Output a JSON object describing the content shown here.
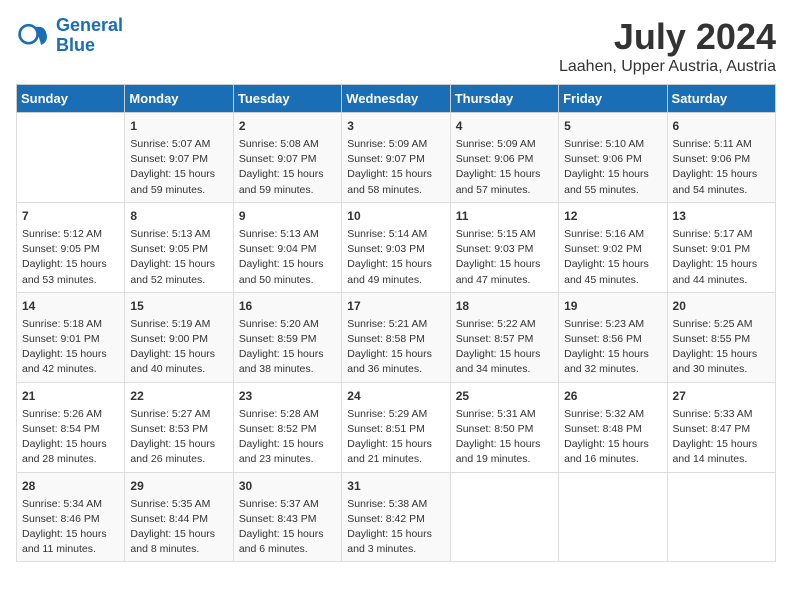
{
  "logo": {
    "line1": "General",
    "line2": "Blue"
  },
  "title": "July 2024",
  "location": "Laahen, Upper Austria, Austria",
  "days_of_week": [
    "Sunday",
    "Monday",
    "Tuesday",
    "Wednesday",
    "Thursday",
    "Friday",
    "Saturday"
  ],
  "weeks": [
    [
      {
        "day": "",
        "info": ""
      },
      {
        "day": "1",
        "info": "Sunrise: 5:07 AM\nSunset: 9:07 PM\nDaylight: 15 hours\nand 59 minutes."
      },
      {
        "day": "2",
        "info": "Sunrise: 5:08 AM\nSunset: 9:07 PM\nDaylight: 15 hours\nand 59 minutes."
      },
      {
        "day": "3",
        "info": "Sunrise: 5:09 AM\nSunset: 9:07 PM\nDaylight: 15 hours\nand 58 minutes."
      },
      {
        "day": "4",
        "info": "Sunrise: 5:09 AM\nSunset: 9:06 PM\nDaylight: 15 hours\nand 57 minutes."
      },
      {
        "day": "5",
        "info": "Sunrise: 5:10 AM\nSunset: 9:06 PM\nDaylight: 15 hours\nand 55 minutes."
      },
      {
        "day": "6",
        "info": "Sunrise: 5:11 AM\nSunset: 9:06 PM\nDaylight: 15 hours\nand 54 minutes."
      }
    ],
    [
      {
        "day": "7",
        "info": "Sunrise: 5:12 AM\nSunset: 9:05 PM\nDaylight: 15 hours\nand 53 minutes."
      },
      {
        "day": "8",
        "info": "Sunrise: 5:13 AM\nSunset: 9:05 PM\nDaylight: 15 hours\nand 52 minutes."
      },
      {
        "day": "9",
        "info": "Sunrise: 5:13 AM\nSunset: 9:04 PM\nDaylight: 15 hours\nand 50 minutes."
      },
      {
        "day": "10",
        "info": "Sunrise: 5:14 AM\nSunset: 9:03 PM\nDaylight: 15 hours\nand 49 minutes."
      },
      {
        "day": "11",
        "info": "Sunrise: 5:15 AM\nSunset: 9:03 PM\nDaylight: 15 hours\nand 47 minutes."
      },
      {
        "day": "12",
        "info": "Sunrise: 5:16 AM\nSunset: 9:02 PM\nDaylight: 15 hours\nand 45 minutes."
      },
      {
        "day": "13",
        "info": "Sunrise: 5:17 AM\nSunset: 9:01 PM\nDaylight: 15 hours\nand 44 minutes."
      }
    ],
    [
      {
        "day": "14",
        "info": "Sunrise: 5:18 AM\nSunset: 9:01 PM\nDaylight: 15 hours\nand 42 minutes."
      },
      {
        "day": "15",
        "info": "Sunrise: 5:19 AM\nSunset: 9:00 PM\nDaylight: 15 hours\nand 40 minutes."
      },
      {
        "day": "16",
        "info": "Sunrise: 5:20 AM\nSunset: 8:59 PM\nDaylight: 15 hours\nand 38 minutes."
      },
      {
        "day": "17",
        "info": "Sunrise: 5:21 AM\nSunset: 8:58 PM\nDaylight: 15 hours\nand 36 minutes."
      },
      {
        "day": "18",
        "info": "Sunrise: 5:22 AM\nSunset: 8:57 PM\nDaylight: 15 hours\nand 34 minutes."
      },
      {
        "day": "19",
        "info": "Sunrise: 5:23 AM\nSunset: 8:56 PM\nDaylight: 15 hours\nand 32 minutes."
      },
      {
        "day": "20",
        "info": "Sunrise: 5:25 AM\nSunset: 8:55 PM\nDaylight: 15 hours\nand 30 minutes."
      }
    ],
    [
      {
        "day": "21",
        "info": "Sunrise: 5:26 AM\nSunset: 8:54 PM\nDaylight: 15 hours\nand 28 minutes."
      },
      {
        "day": "22",
        "info": "Sunrise: 5:27 AM\nSunset: 8:53 PM\nDaylight: 15 hours\nand 26 minutes."
      },
      {
        "day": "23",
        "info": "Sunrise: 5:28 AM\nSunset: 8:52 PM\nDaylight: 15 hours\nand 23 minutes."
      },
      {
        "day": "24",
        "info": "Sunrise: 5:29 AM\nSunset: 8:51 PM\nDaylight: 15 hours\nand 21 minutes."
      },
      {
        "day": "25",
        "info": "Sunrise: 5:31 AM\nSunset: 8:50 PM\nDaylight: 15 hours\nand 19 minutes."
      },
      {
        "day": "26",
        "info": "Sunrise: 5:32 AM\nSunset: 8:48 PM\nDaylight: 15 hours\nand 16 minutes."
      },
      {
        "day": "27",
        "info": "Sunrise: 5:33 AM\nSunset: 8:47 PM\nDaylight: 15 hours\nand 14 minutes."
      }
    ],
    [
      {
        "day": "28",
        "info": "Sunrise: 5:34 AM\nSunset: 8:46 PM\nDaylight: 15 hours\nand 11 minutes."
      },
      {
        "day": "29",
        "info": "Sunrise: 5:35 AM\nSunset: 8:44 PM\nDaylight: 15 hours\nand 8 minutes."
      },
      {
        "day": "30",
        "info": "Sunrise: 5:37 AM\nSunset: 8:43 PM\nDaylight: 15 hours\nand 6 minutes."
      },
      {
        "day": "31",
        "info": "Sunrise: 5:38 AM\nSunset: 8:42 PM\nDaylight: 15 hours\nand 3 minutes."
      },
      {
        "day": "",
        "info": ""
      },
      {
        "day": "",
        "info": ""
      },
      {
        "day": "",
        "info": ""
      }
    ]
  ]
}
